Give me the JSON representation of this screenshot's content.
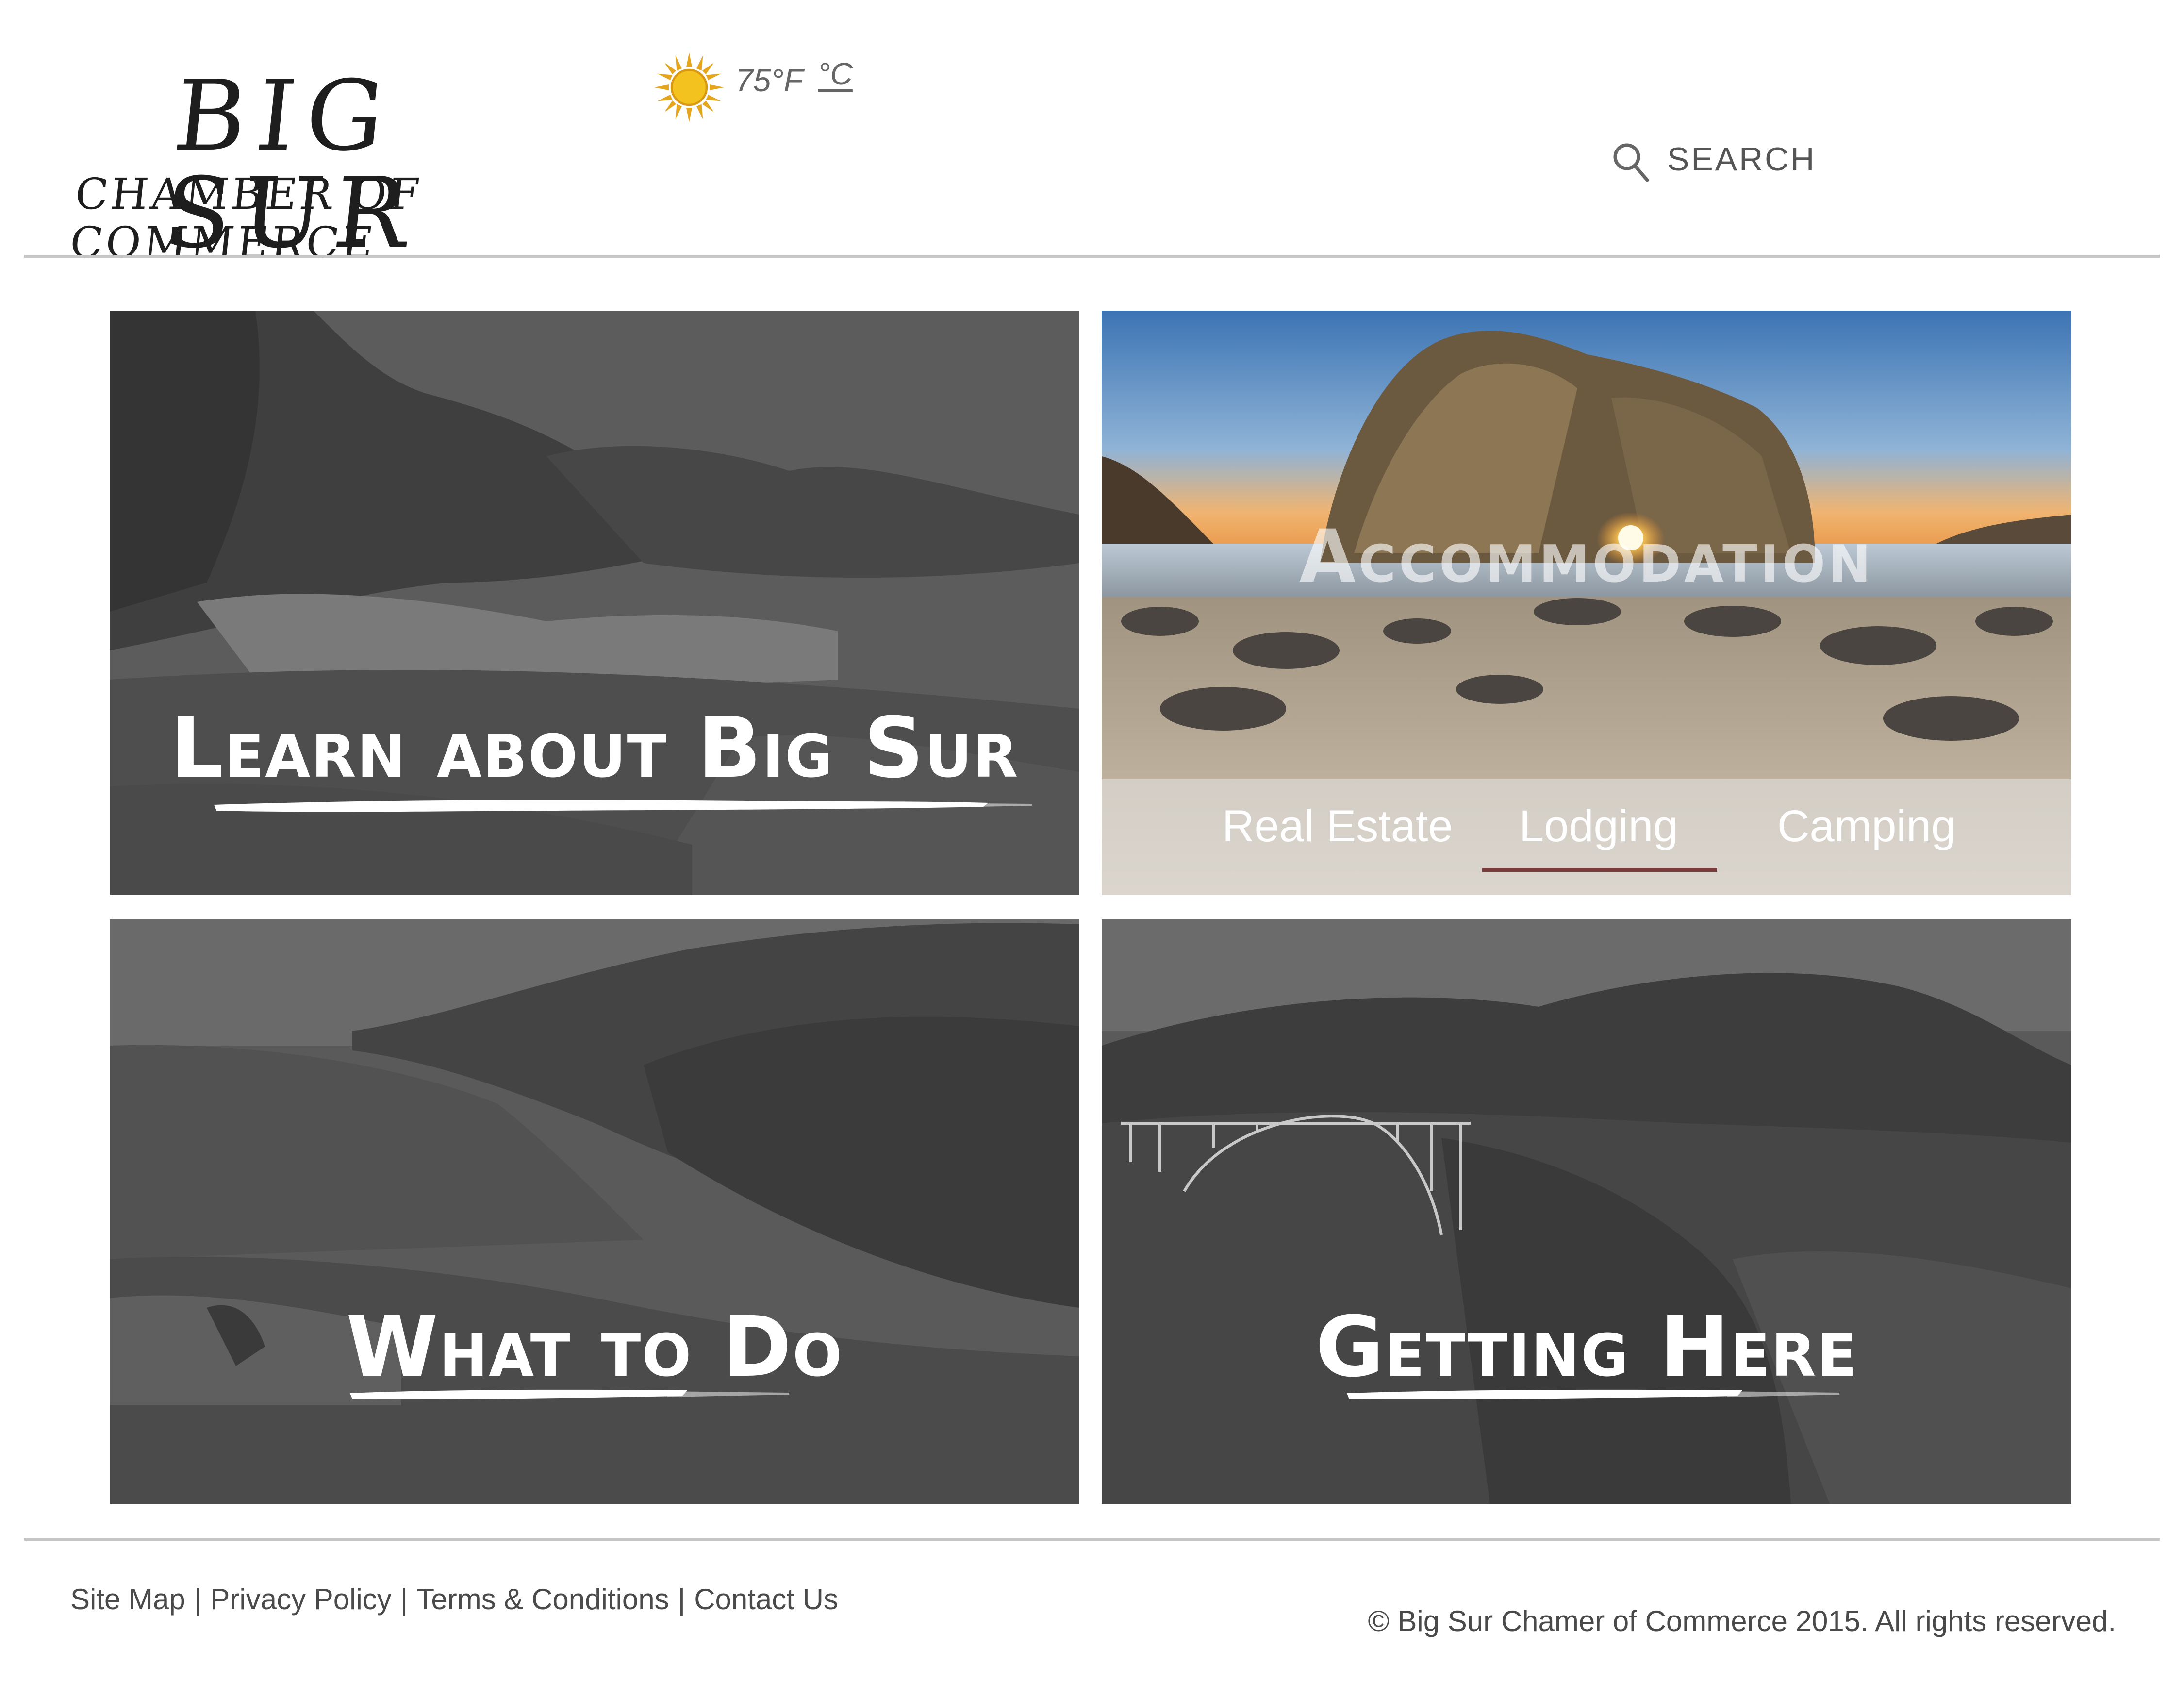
{
  "header": {
    "logo_main": "BIG SUR",
    "logo_sub": "CHAMBER OF COMMERCE",
    "weather": {
      "icon": "sun-icon",
      "temp_f": "75°F",
      "unit_c": "°C"
    },
    "search": {
      "icon": "search-icon",
      "label": "SEARCH"
    }
  },
  "tiles": {
    "learn": {
      "title": "Learn about Big Sur"
    },
    "accommodation": {
      "title": "Accommodation",
      "links": [
        "Real Estate",
        "Lodging",
        "Camping"
      ],
      "active_link": "Lodging"
    },
    "what_to_do": {
      "title": "What to Do"
    },
    "getting_here": {
      "title": "Getting Here"
    }
  },
  "footer": {
    "links": [
      "Site Map",
      "Privacy Policy",
      "Terms & Conditions",
      "Contact Us"
    ],
    "separator": "|",
    "copyright": "© Big Sur Chamer of Commerce 2015. All rights reserved."
  },
  "colors": {
    "active_underline": "#7a3b3b",
    "tile_overlay": "#5a5a5a",
    "rule": "#c6c6c6"
  }
}
